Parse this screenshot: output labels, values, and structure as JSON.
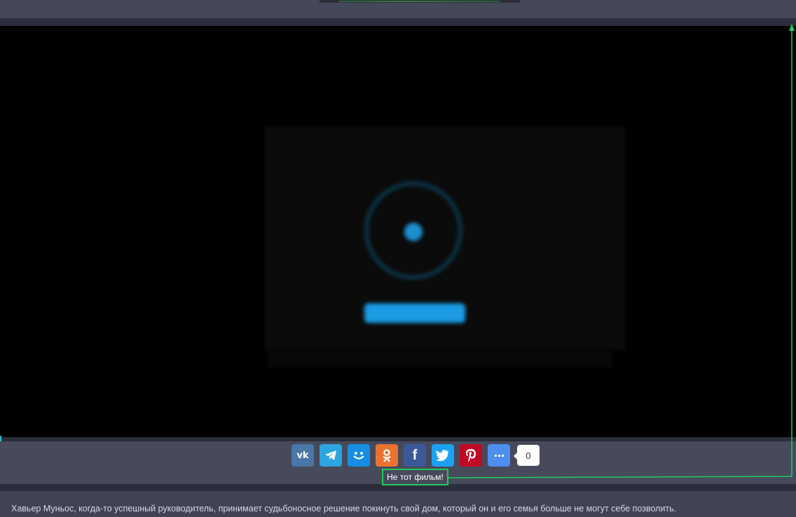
{
  "share": {
    "buttons": [
      {
        "network": "vk",
        "glyph": "vk",
        "color": "#4a76a8"
      },
      {
        "network": "telegram",
        "glyph": "➤",
        "color": "#2ca5e0"
      },
      {
        "network": "moimir",
        "glyph": "◡",
        "color": "#168de2"
      },
      {
        "network": "odnoklassniki",
        "glyph": "ок",
        "color": "#eb722e"
      },
      {
        "network": "facebook",
        "glyph": "f",
        "color": "#3b5998"
      },
      {
        "network": "twitter",
        "glyph": "🐦",
        "color": "#1da1f2"
      },
      {
        "network": "pinterest",
        "glyph": "P",
        "color": "#c20724"
      },
      {
        "network": "more",
        "glyph": "···",
        "color": "#4d8ef0"
      }
    ],
    "count": "0"
  },
  "wrong_film_label": "Не тот фильм!",
  "description": "Хавьер Муньос, когда-то успешный руководитель, принимает судьбоносное решение покинуть свой дом, который он и его семья больше не могут себе позволить.",
  "icons": {
    "play": "play-icon",
    "vk": "vk-icon",
    "telegram": "telegram-icon",
    "moimir": "moimir-icon",
    "odnoklassniki": "odnoklassniki-icon",
    "facebook": "facebook-icon",
    "twitter": "twitter-icon",
    "pinterest": "pinterest-icon",
    "more": "more-icon"
  },
  "colors": {
    "annotation": "#22c95c",
    "accent": "#1a9be3"
  }
}
